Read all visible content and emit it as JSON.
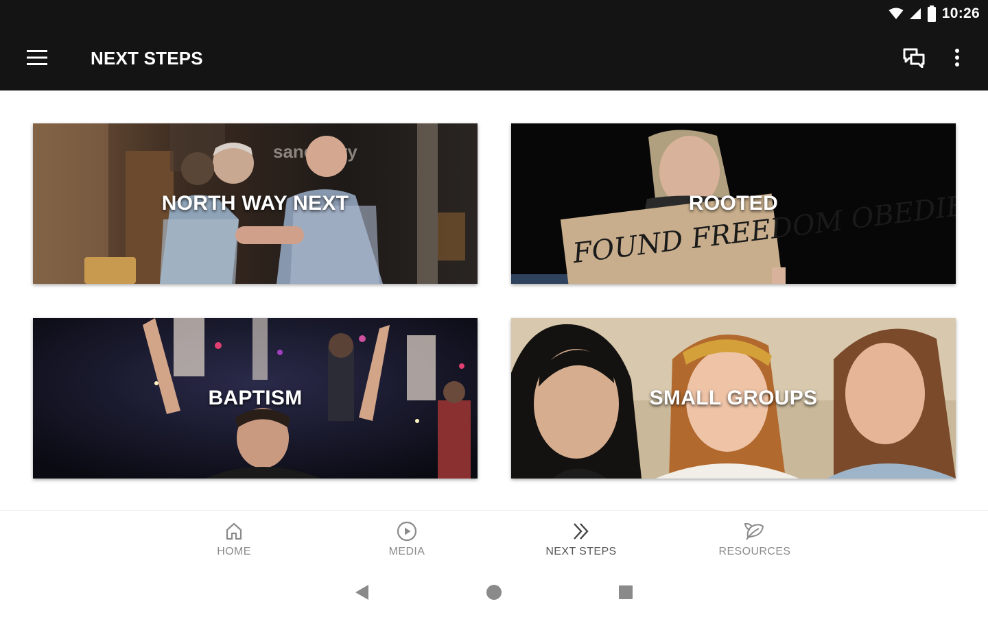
{
  "status_bar": {
    "time": "10:26",
    "icons": [
      "wifi-icon",
      "signal-icon",
      "battery-icon"
    ]
  },
  "app_bar": {
    "title": "NEXT STEPS",
    "menu_icon": "hamburger-menu-icon",
    "chat_icon": "chat-icon",
    "more_icon": "more-vert-icon"
  },
  "cards": [
    {
      "title": "NORTH WAY NEXT",
      "background_text": "sanctuary"
    },
    {
      "title": "ROOTED",
      "background_text": "FOUND FREEDOM OBEDIENCE"
    },
    {
      "title": "BAPTISM"
    },
    {
      "title": "SMALL GROUPS"
    }
  ],
  "bottom_nav": {
    "items": [
      {
        "label": "HOME",
        "icon": "home-icon",
        "active": false
      },
      {
        "label": "MEDIA",
        "icon": "play-circle-icon",
        "active": false
      },
      {
        "label": "NEXT STEPS",
        "icon": "double-chevron-right-icon",
        "active": true
      },
      {
        "label": "RESOURCES",
        "icon": "leaf-icon",
        "active": false
      }
    ]
  },
  "system_nav": {
    "back_icon": "back-triangle-icon",
    "home_icon": "home-circle-icon",
    "recents_icon": "recents-square-icon"
  },
  "colors": {
    "app_bar_bg": "#141414",
    "background": "#ffffff",
    "nav_label": "#8a8a8a",
    "nav_label_active": "#555555"
  }
}
